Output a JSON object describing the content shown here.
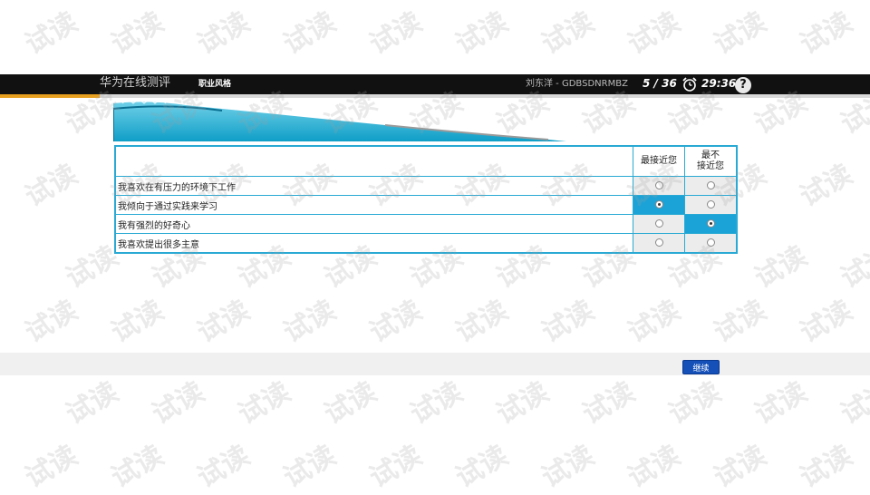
{
  "header": {
    "app_title": "华为在线测评",
    "section_name": "职业风格",
    "user_id": "刘东洋 - GDBSDNRMBZ",
    "progress": "5 / 36",
    "timer": "29:36",
    "help_label": "?"
  },
  "table": {
    "columns": [
      "最接近您",
      "最不\n接近您"
    ],
    "rows": [
      {
        "statement": "我喜欢在有压力的环境下工作",
        "selected": null
      },
      {
        "statement": "我倾向于通过实践来学习",
        "selected": 0
      },
      {
        "statement": "我有强烈的好奇心",
        "selected": 1
      },
      {
        "statement": "我喜欢提出很多主意",
        "selected": null
      }
    ]
  },
  "footer": {
    "continue_label": "继续"
  },
  "watermark": "试读",
  "colors": {
    "accent": "#1ba3d8",
    "header_bg": "#111111",
    "button": "#1450b8",
    "orange": "#e8a020"
  }
}
